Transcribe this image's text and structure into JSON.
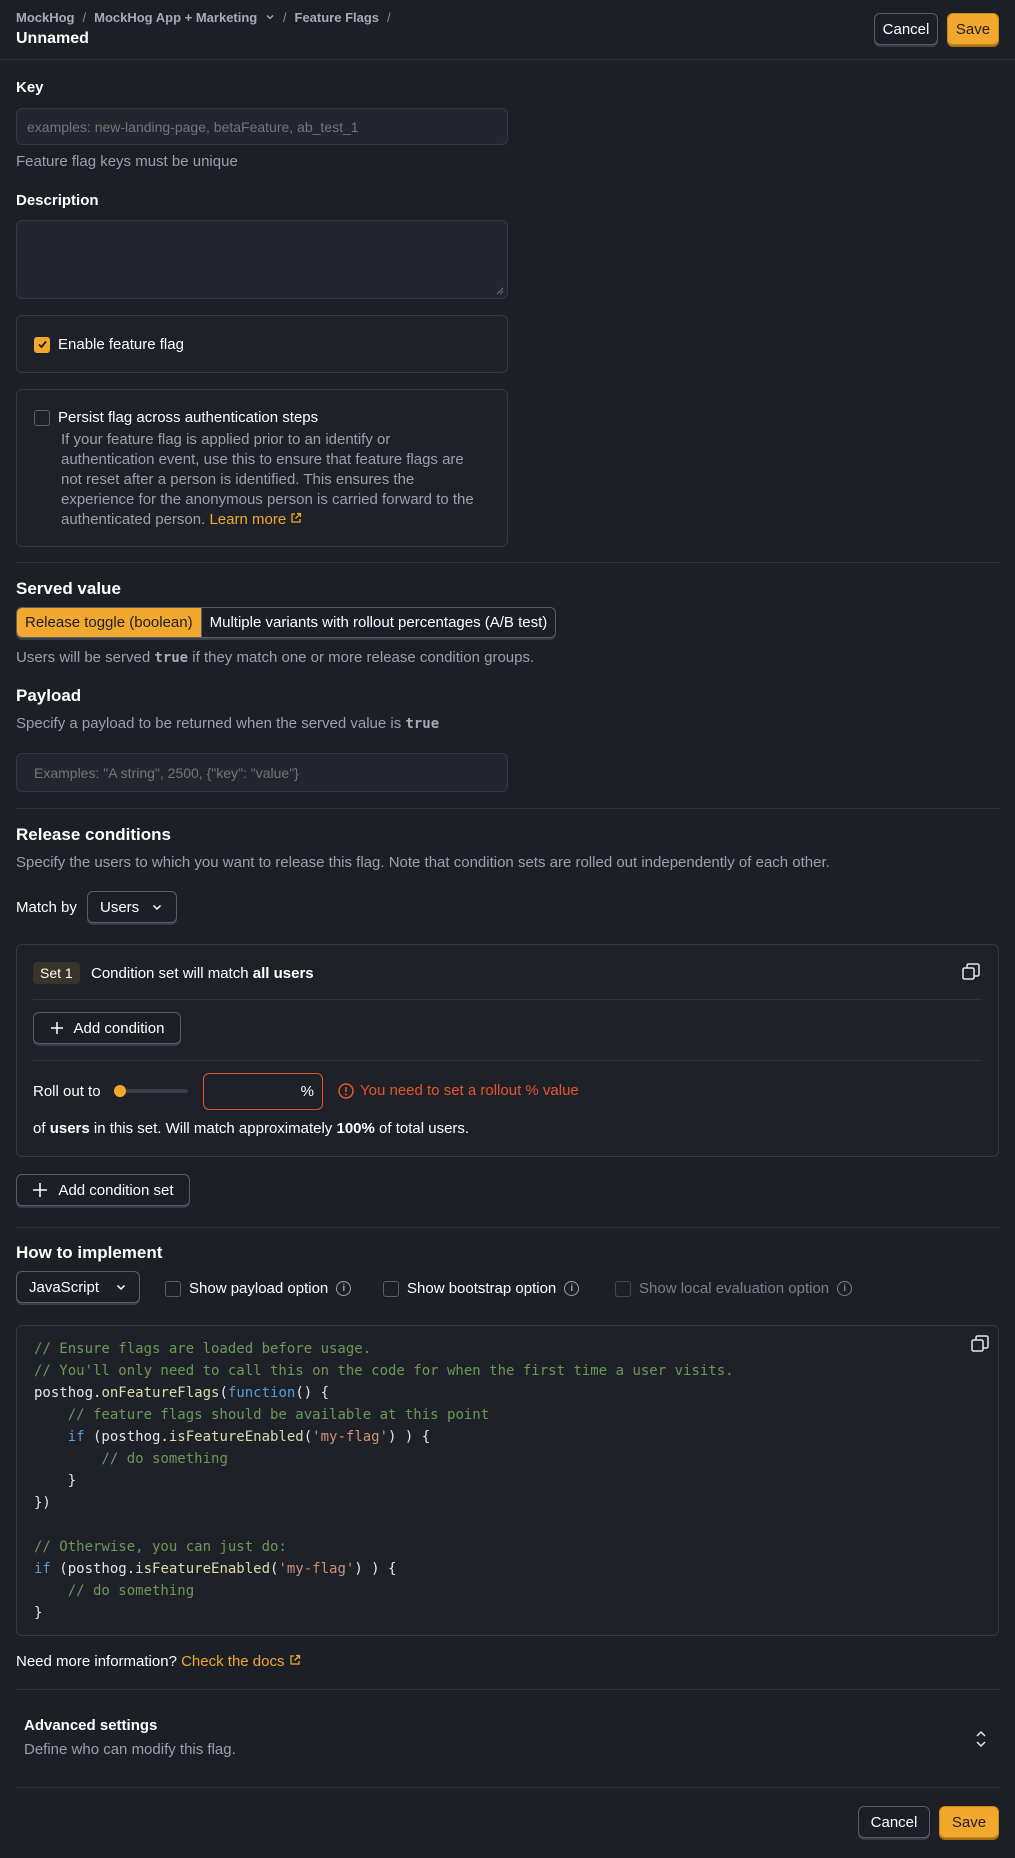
{
  "header": {
    "breadcrumb": [
      "MockHog",
      "MockHog App + Marketing",
      "Feature Flags"
    ],
    "title": "Unnamed",
    "cancel_label": "Cancel",
    "save_label": "Save"
  },
  "key": {
    "label": "Key",
    "placeholder": "examples: new-landing-page, betaFeature, ab_test_1",
    "help": "Feature flag keys must be unique"
  },
  "description": {
    "label": "Description",
    "value": ""
  },
  "enable": {
    "label": "Enable feature flag",
    "checked": true
  },
  "persist": {
    "label": "Persist flag across authentication steps",
    "checked": false,
    "help_lines": [
      "If your feature flag is applied prior to an identify or",
      "authentication event, use this to ensure that feature flags are",
      "not reset after a person is identified. This ensures the",
      "experience for the anonymous person is carried forward to the"
    ],
    "help_last": "authenticated person.",
    "learn_more": "Learn more"
  },
  "served_value": {
    "title": "Served value",
    "options": [
      "Release toggle (boolean)",
      "Multiple variants with rollout percentages (A/B test)"
    ],
    "selected": 0,
    "help_prefix": "Users will be served",
    "help_code": "true",
    "help_suffix": "if they match one or more release condition groups."
  },
  "payload": {
    "title": "Payload",
    "help_prefix": "Specify a payload to be returned when the served value is",
    "help_code": "true",
    "placeholder": "Examples: \"A string\", 2500, {\"key\": \"value\"}"
  },
  "release_conditions": {
    "title": "Release conditions",
    "help": "Specify the users to which you want to release this flag. Note that condition sets are rolled out independently of each other.",
    "match_by_label": "Match by",
    "match_by_value": "Users",
    "set": {
      "badge": "Set 1",
      "summary_prefix": "Condition set will match",
      "summary_bold": "all users",
      "add_condition": "Add condition",
      "rollout_label": "Roll out to",
      "rollout_value": "",
      "rollout_percent": 0,
      "percent_sign": "%",
      "error": "You need to set a rollout % value",
      "footer_of": "of",
      "footer_users": "users",
      "footer_mid": "in this set. Will match approximately",
      "footer_pct": "100%",
      "footer_end": "of total users."
    },
    "add_condition_set": "Add condition set"
  },
  "implement": {
    "title": "How to implement",
    "language": "JavaScript",
    "options": [
      {
        "label": "Show payload option",
        "checked": false,
        "enabled": true
      },
      {
        "label": "Show bootstrap option",
        "checked": false,
        "enabled": true
      },
      {
        "label": "Show local evaluation option",
        "checked": false,
        "enabled": false
      }
    ],
    "need_more": "Need more information?",
    "docs_link": "Check the docs"
  },
  "advanced": {
    "title": "Advanced settings",
    "subtitle": "Define who can modify this flag."
  },
  "footer": {
    "cancel_label": "Cancel",
    "save_label": "Save"
  },
  "colors": {
    "accent": "#f1a82c",
    "error": "#e5532d",
    "background": "#1d1f27"
  }
}
